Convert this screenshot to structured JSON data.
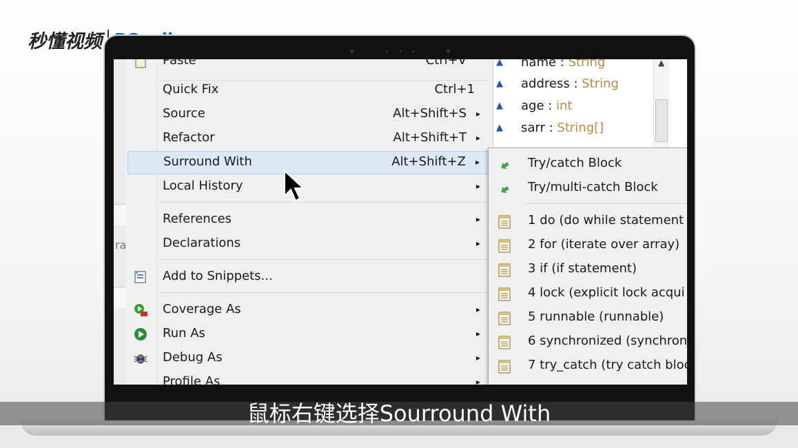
{
  "logo": {
    "brand": "秒懂视频",
    "partner": "PConline"
  },
  "menu": {
    "partial_top": "Paste",
    "partial_top_accel": "Ctrl+V",
    "items": [
      {
        "label": "Quick Fix",
        "accel": "Ctrl+1",
        "submenu": false
      },
      {
        "label": "Source",
        "accel": "Alt+Shift+S",
        "submenu": true
      },
      {
        "label": "Refactor",
        "accel": "Alt+Shift+T",
        "submenu": true
      },
      {
        "label": "Surround With",
        "accel": "Alt+Shift+Z",
        "submenu": true,
        "selected": true
      },
      {
        "label": "Local History",
        "accel": "",
        "submenu": true
      },
      {
        "label": "References",
        "accel": "",
        "submenu": true
      },
      {
        "label": "Declarations",
        "accel": "",
        "submenu": true
      },
      {
        "label": "Add to Snippets...",
        "accel": "",
        "submenu": false
      },
      {
        "label": "Coverage As",
        "accel": "",
        "submenu": true
      },
      {
        "label": "Run As",
        "accel": "",
        "submenu": true
      },
      {
        "label": "Debug As",
        "accel": "",
        "submenu": true
      },
      {
        "label": "Profile As",
        "accel": "",
        "submenu": true
      }
    ],
    "arrow": "▸"
  },
  "submenu": {
    "items": [
      {
        "label": "Try/catch Block",
        "icon": "try-catch-icon"
      },
      {
        "label": "Try/multi-catch Block",
        "icon": "try-catch-icon"
      },
      {
        "label": "1 do (do while statement",
        "icon": "template-icon"
      },
      {
        "label": "2 for (iterate over array)",
        "icon": "template-icon"
      },
      {
        "label": "3 if (if statement)",
        "icon": "template-icon"
      },
      {
        "label": "4 lock (explicit lock acqui",
        "icon": "template-icon"
      },
      {
        "label": "5 runnable (runnable)",
        "icon": "template-icon"
      },
      {
        "label": "6 synchronized (synchron",
        "icon": "template-icon"
      },
      {
        "label": "7 try_catch (try catch bloc",
        "icon": "template-icon"
      }
    ]
  },
  "outline": {
    "fields": [
      {
        "name": "name",
        "type": "String"
      },
      {
        "name": "address",
        "type": "String"
      },
      {
        "name": "age",
        "type": "int"
      },
      {
        "name": "sarr",
        "type": "String[]"
      }
    ]
  },
  "left_fragment": "ra",
  "subtitle": "鼠标右键选择Sourround With",
  "colors": {
    "selection": "#dde8f5",
    "type_text": "#b88a48",
    "brand_blue": "#1f5bd1"
  }
}
